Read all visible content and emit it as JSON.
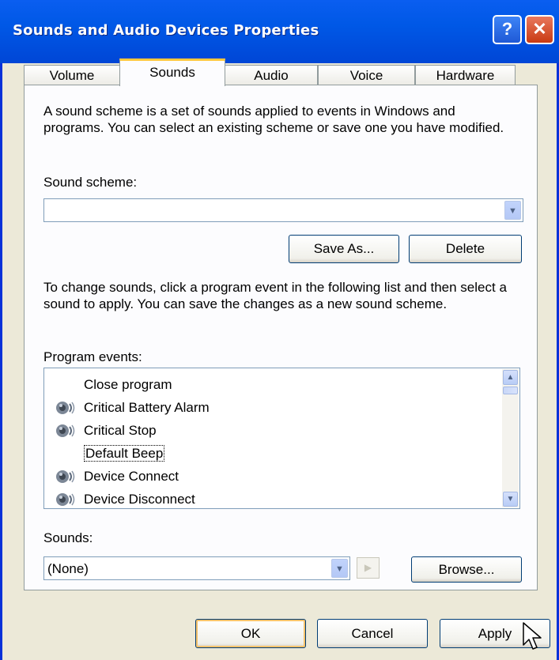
{
  "window": {
    "title": "Sounds and Audio Devices Properties",
    "help_glyph": "?",
    "close_glyph": "✕"
  },
  "tabs": [
    "Volume",
    "Sounds",
    "Audio",
    "Voice",
    "Hardware"
  ],
  "active_tab": "Sounds",
  "intro_text": "A sound scheme is a set of sounds applied to events in Windows and programs. You can select an existing scheme or save one you have modified.",
  "sound_scheme": {
    "label": "Sound scheme:",
    "value": ""
  },
  "buttons": {
    "save_as": "Save As...",
    "delete": "Delete",
    "browse": "Browse...",
    "ok": "OK",
    "cancel": "Cancel",
    "apply": "Apply"
  },
  "change_text": "To change sounds, click a program event in the following list and then select a sound to apply. You can save the changes as a new sound scheme.",
  "program_events": {
    "label": "Program events:",
    "items": [
      {
        "label": "Close program",
        "icon": "speaker-icon",
        "has_icon": false
      },
      {
        "label": "Critical Battery Alarm",
        "icon": "speaker-icon",
        "has_icon": true
      },
      {
        "label": "Critical Stop",
        "icon": "speaker-icon",
        "has_icon": true
      },
      {
        "label": "Default Beep",
        "icon": "speaker-icon",
        "has_icon": false,
        "focused": true
      },
      {
        "label": "Device Connect",
        "icon": "speaker-icon",
        "has_icon": true
      },
      {
        "label": "Device Disconnect",
        "icon": "speaker-icon",
        "has_icon": true
      }
    ]
  },
  "sounds": {
    "label": "Sounds:",
    "value": "(None)"
  },
  "colors": {
    "title_bar": "#0058E6",
    "dialog_bg": "#ECE9D8",
    "active_tab_accent": "#FFC83C",
    "close_button": "#C93A12"
  }
}
